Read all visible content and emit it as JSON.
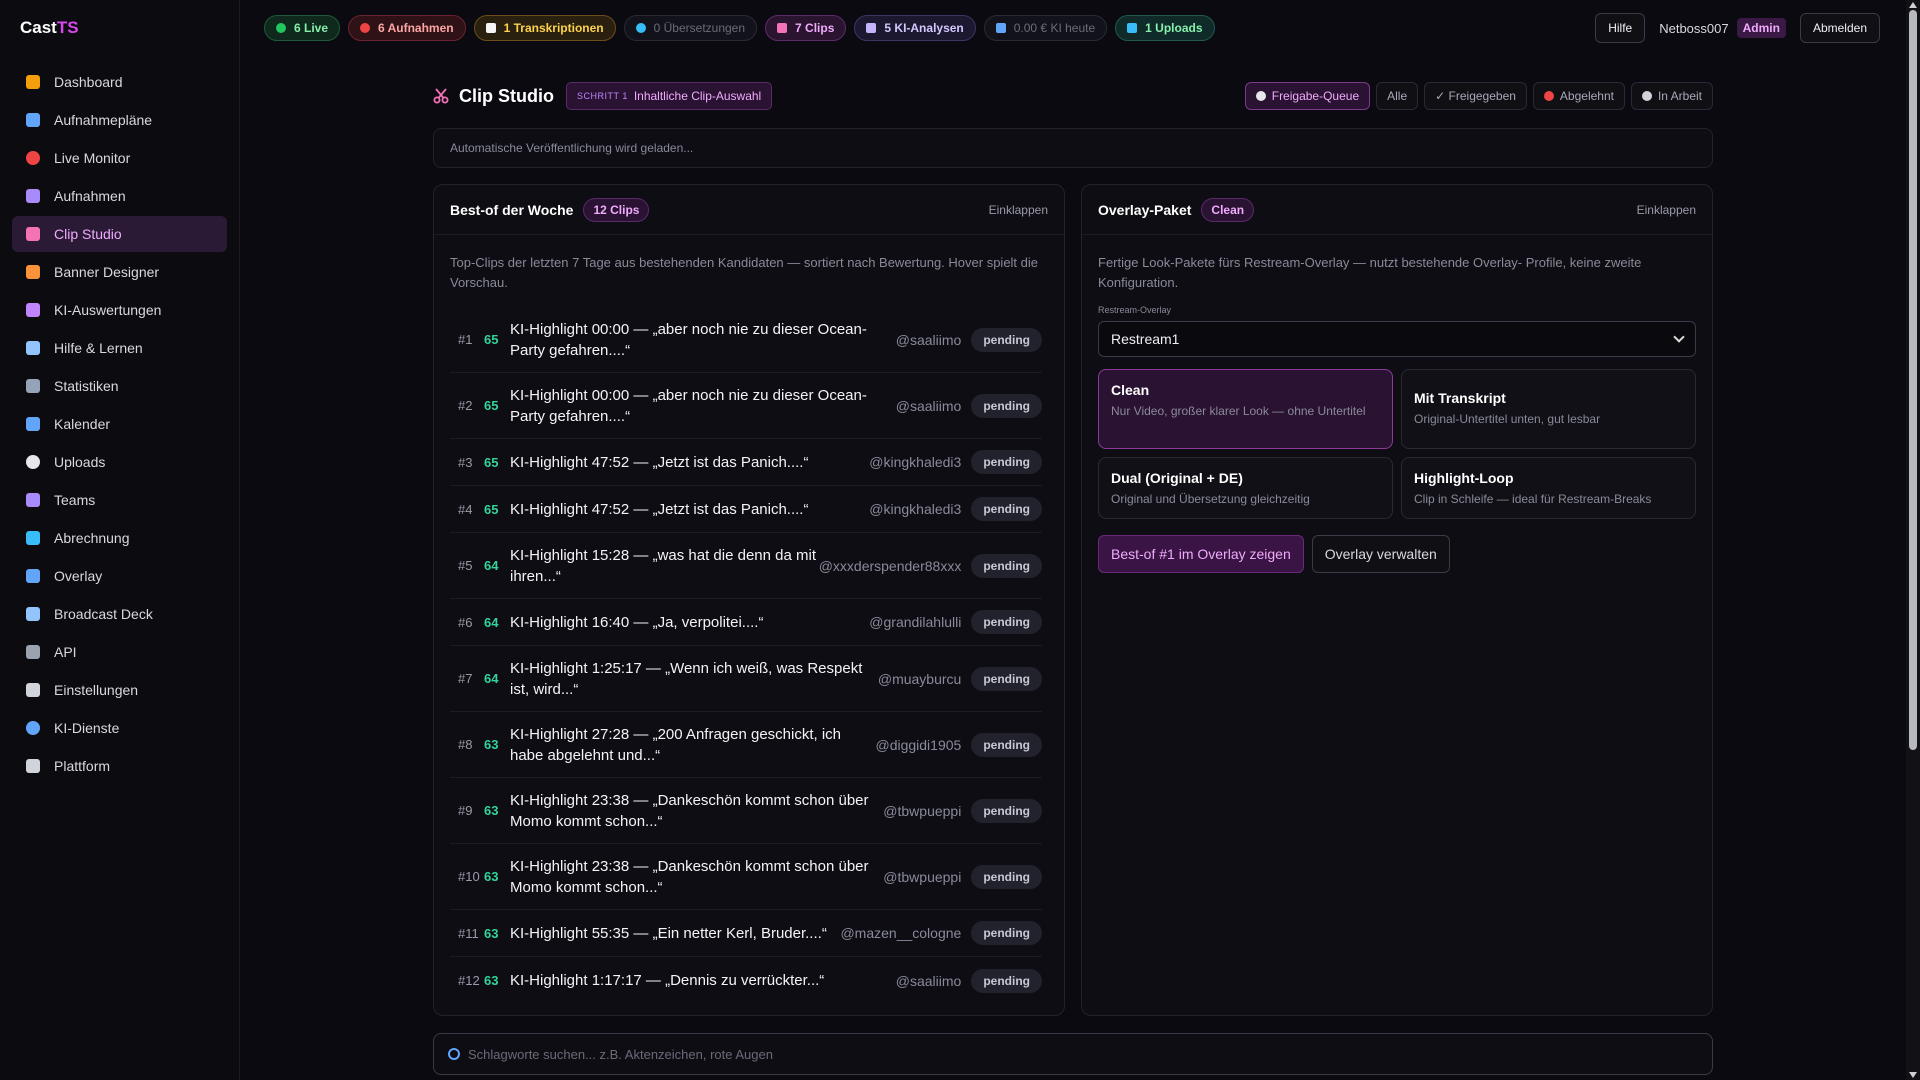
{
  "brand": {
    "name": "Cast",
    "accent": "TS"
  },
  "sidebar": {
    "items": [
      {
        "label": "Dashboard",
        "icon": "house-icon",
        "color": "#f59e0b"
      },
      {
        "label": "Aufnahmepläne",
        "icon": "calendar-schedule-icon",
        "color": "#60a5fa"
      },
      {
        "label": "Live Monitor",
        "icon": "red-circle-icon",
        "color": "#ef4444"
      },
      {
        "label": "Aufnahmen",
        "icon": "recordings-icon",
        "color": "#a78bfa"
      },
      {
        "label": "Clip Studio",
        "icon": "scissors-icon",
        "color": "#f472b6"
      },
      {
        "label": "Banner Designer",
        "icon": "palette-icon",
        "color": "#fb923c"
      },
      {
        "label": "KI-Auswertungen",
        "icon": "robot-icon",
        "color": "#c084fc"
      },
      {
        "label": "Hilfe & Lernen",
        "icon": "book-icon",
        "color": "#93c5fd"
      },
      {
        "label": "Statistiken",
        "icon": "chart-icon",
        "color": "#94a3b8"
      },
      {
        "label": "Kalender",
        "icon": "calendar-icon",
        "color": "#60a5fa"
      },
      {
        "label": "Uploads",
        "icon": "cloud-icon",
        "color": "#e5e7eb"
      },
      {
        "label": "Teams",
        "icon": "people-icon",
        "color": "#a78bfa"
      },
      {
        "label": "Abrechnung",
        "icon": "billing-icon",
        "color": "#38bdf8"
      },
      {
        "label": "Overlay",
        "icon": "overlay-icon",
        "color": "#60a5fa"
      },
      {
        "label": "Broadcast Deck",
        "icon": "grid-icon",
        "color": "#93c5fd"
      },
      {
        "label": "API",
        "icon": "plug-icon",
        "color": "#9ca3af"
      },
      {
        "label": "Einstellungen",
        "icon": "gear-icon",
        "color": "#d1d5db"
      },
      {
        "label": "KI-Dienste",
        "icon": "shield-icon",
        "color": "#60a5fa"
      },
      {
        "label": "Plattform",
        "icon": "building-icon",
        "color": "#d1d5db"
      }
    ],
    "active_index": 4
  },
  "topbar": {
    "pills": [
      {
        "label": "6 Live",
        "style": "p-live",
        "icon": "green-dot-icon",
        "color": "#22c55e"
      },
      {
        "label": "6 Aufnahmen",
        "style": "p-rec",
        "icon": "red-dot-icon",
        "color": "#ef4444"
      },
      {
        "label": "1 Transkriptionen",
        "style": "p-trans",
        "icon": "document-icon",
        "color": "#f5f5f5"
      },
      {
        "label": "0 Übersetzungen",
        "style": "p-dim",
        "icon": "globe-icon",
        "color": "#38bdf8"
      },
      {
        "label": "7 Clips",
        "style": "p-clips",
        "icon": "scissors-icon",
        "color": "#f472b6"
      },
      {
        "label": "5 KI-Analysen",
        "style": "p-ki",
        "icon": "robot-icon",
        "color": "#c4b5fd"
      },
      {
        "label": "0.00 € KI heute",
        "style": "p-dim",
        "icon": "chart-icon",
        "color": "#60a5fa"
      },
      {
        "label": "1 Uploads",
        "style": "p-up",
        "icon": "upload-icon",
        "color": "#38bdf8"
      }
    ],
    "help_label": "Hilfe",
    "username": "Netboss007",
    "role": "Admin",
    "logout_label": "Abmelden"
  },
  "page": {
    "title": "Clip Studio",
    "step_small": "SCHRITT 1",
    "step_label": "Inhaltliche Clip-Auswahl",
    "filters": [
      {
        "label": "Freigabe-Queue",
        "active": true,
        "icon": "clock-icon",
        "color": "#e5e7eb"
      },
      {
        "label": "Alle",
        "active": false,
        "icon": "",
        "color": ""
      },
      {
        "label": "✓ Freigegeben",
        "active": false,
        "icon": "",
        "color": ""
      },
      {
        "label": "Abgelehnt",
        "active": false,
        "icon": "no-entry-icon",
        "color": "#ef4444"
      },
      {
        "label": "In Arbeit",
        "active": false,
        "icon": "gear-icon",
        "color": "#d1d5db"
      }
    ],
    "status_text": "Automatische Veröffentlichung wird geladen..."
  },
  "best_of": {
    "title": "Best-of der Woche",
    "count": "12 Clips",
    "collapse_label": "Einklappen",
    "description": "Top-Clips der letzten 7 Tage aus bestehenden Kandidaten — sortiert nach Bewertung. Hover spielt die Vorschau.",
    "clips": [
      {
        "rank": "#1",
        "score": "65",
        "title": "KI-Highlight 00:00 — „aber noch nie zu dieser Ocean-Party gefahren....“",
        "author": "@saaliimo",
        "state": "pending",
        "lines": 2
      },
      {
        "rank": "#2",
        "score": "65",
        "title": "KI-Highlight 00:00 — „aber noch nie zu dieser Ocean-Party gefahren....“",
        "author": "@saaliimo",
        "state": "pending",
        "lines": 2
      },
      {
        "rank": "#3",
        "score": "65",
        "title": "KI-Highlight 47:52 — „Jetzt ist das Panich....“",
        "author": "@kingkhaledi3",
        "state": "pending",
        "lines": 1
      },
      {
        "rank": "#4",
        "score": "65",
        "title": "KI-Highlight 47:52 — „Jetzt ist das Panich....“",
        "author": "@kingkhaledi3",
        "state": "pending",
        "lines": 1
      },
      {
        "rank": "#5",
        "score": "64",
        "title": "KI-Highlight 15:28 — „was hat die denn da mit ihren...“",
        "author": "@xxxderspender88xxx",
        "state": "pending",
        "lines": 2
      },
      {
        "rank": "#6",
        "score": "64",
        "title": "KI-Highlight 16:40 — „Ja, verpolitei....“",
        "author": "@grandilahlulli",
        "state": "pending",
        "lines": 1
      },
      {
        "rank": "#7",
        "score": "64",
        "title": "KI-Highlight 1:25:17 — „Wenn ich weiß, was Respekt ist, wird...“",
        "author": "@muayburcu",
        "state": "pending",
        "lines": 2
      },
      {
        "rank": "#8",
        "score": "63",
        "title": "KI-Highlight 27:28 — „200 Anfragen geschickt, ich habe abgelehnt und...“",
        "author": "@diggidi1905",
        "state": "pending",
        "lines": 2
      },
      {
        "rank": "#9",
        "score": "63",
        "title": "KI-Highlight 23:38 — „Dankeschön kommt schon über Momo kommt schon...“",
        "author": "@tbwpueppi",
        "state": "pending",
        "lines": 2
      },
      {
        "rank": "#10",
        "score": "63",
        "title": "KI-Highlight 23:38 — „Dankeschön kommt schon über Momo kommt schon...“",
        "author": "@tbwpueppi",
        "state": "pending",
        "lines": 2
      },
      {
        "rank": "#11",
        "score": "63",
        "title": "KI-Highlight 55:35 — „Ein netter Kerl, Bruder....“",
        "author": "@mazen__cologne",
        "state": "pending",
        "lines": 1
      },
      {
        "rank": "#12",
        "score": "63",
        "title": "KI-Highlight 1:17:17 — „Dennis zu verrückter...“",
        "author": "@saaliimo",
        "state": "pending",
        "lines": 1
      }
    ]
  },
  "overlay": {
    "title": "Overlay-Paket",
    "badge": "Clean",
    "collapse_label": "Einklappen",
    "description": "Fertige Look-Pakete fürs Restream-Overlay — nutzt bestehende Overlay- Profile, keine zweite Konfiguration.",
    "select_label": "Restream-Overlay",
    "select_value": "Restream1",
    "looks": [
      {
        "title": "Clean",
        "desc": "Nur Video, großer klarer Look — ohne Untertitel",
        "selected": true
      },
      {
        "title": "Mit Transkript",
        "desc": "Original-Untertitel unten, gut lesbar",
        "selected": false
      },
      {
        "title": "Dual (Original + DE)",
        "desc": "Original und Übersetzung gleichzeitig",
        "selected": false
      },
      {
        "title": "Highlight-Loop",
        "desc": "Clip in Schleife — ideal für Restream-Breaks",
        "selected": false
      }
    ],
    "primary_action": "Best-of #1 im Overlay zeigen",
    "secondary_action": "Overlay verwalten"
  },
  "search": {
    "placeholder": "Schlagworte suchen... z.B. Aktenzeichen, rote Augen",
    "value": ""
  }
}
